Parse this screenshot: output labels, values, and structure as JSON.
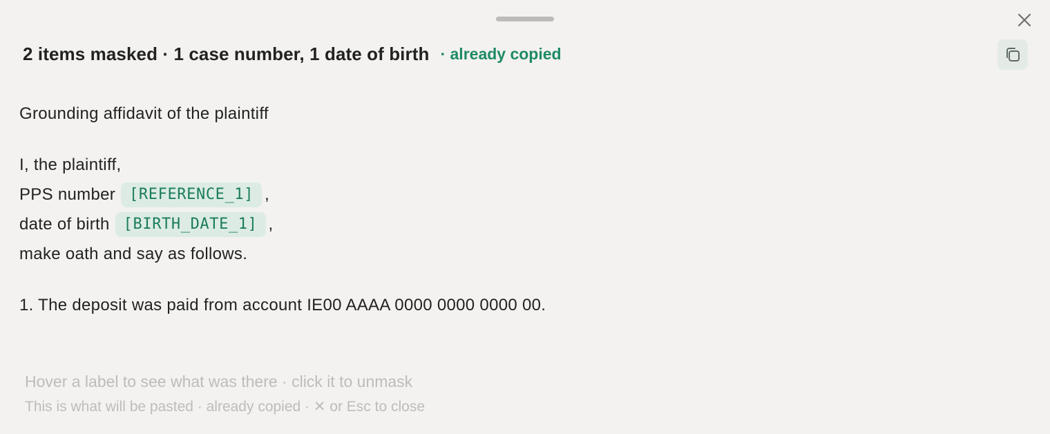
{
  "header": {
    "title": "2 items masked · 1 case number, 1 date of birth",
    "status": "· already copied"
  },
  "icons": {
    "close": "close-icon",
    "copy": "copy-icon",
    "grabber": "drag-handle"
  },
  "document": {
    "heading": "Grounding affidavit of the plaintiff",
    "intro": "I, the plaintiff,",
    "pps_label": "PPS number",
    "pps_mask": "[REFERENCE_1]",
    "pps_suffix": ",",
    "dob_label": "date of birth",
    "dob_mask": "[BIRTH_DATE_1]",
    "dob_suffix": ",",
    "oath": "make oath and say as follows.",
    "paragraph_1": "1. The deposit was paid from account IE00 AAAA 0000 0000 0000 00."
  },
  "footer": {
    "hint": "Hover a label to see what was there · click it to unmask",
    "status": "This is what will be pasted · already copied · ✕ or Esc to close"
  },
  "colors": {
    "background": "#f3f2f0",
    "accent": "#1f8a66",
    "mask_bg": "#dcece4",
    "mask_text": "#1b7c5c",
    "hint_text": "#bdbcba"
  }
}
